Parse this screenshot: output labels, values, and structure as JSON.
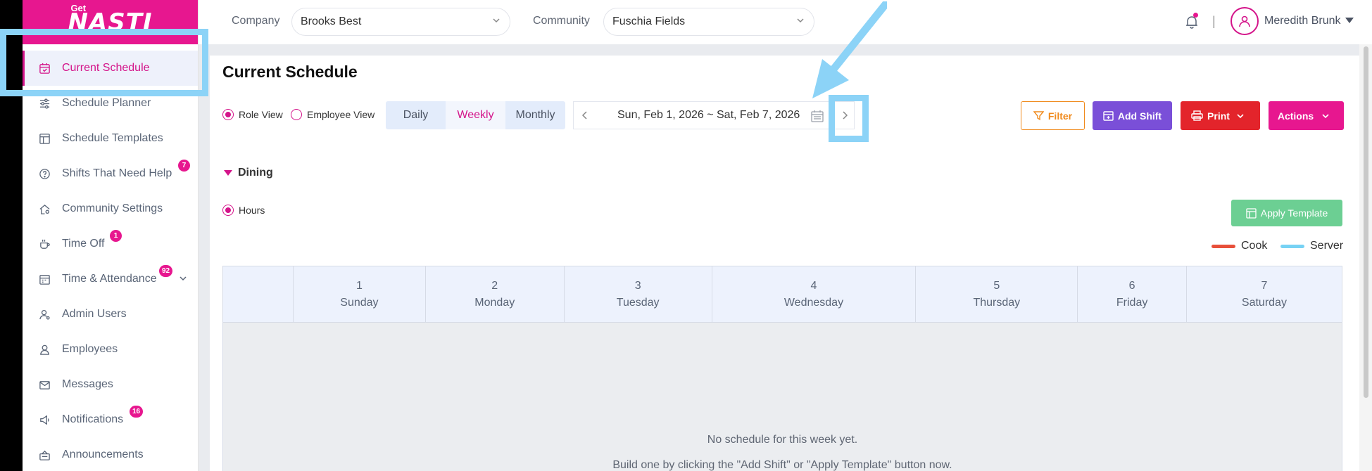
{
  "logo": {
    "text": "NASTI",
    "prefix": "Get"
  },
  "sidebar": {
    "items": [
      {
        "label": "Current Schedule",
        "icon": "calendar-icon",
        "active": true
      },
      {
        "label": "Schedule Planner",
        "icon": "sliders-icon"
      },
      {
        "label": "Schedule Templates",
        "icon": "template-icon"
      },
      {
        "label": "Shifts That Need Help",
        "icon": "help-circle-icon",
        "badge": "7"
      },
      {
        "label": "Community Settings",
        "icon": "home-gear-icon"
      },
      {
        "label": "Time Off",
        "icon": "coffee-icon",
        "badge": "1"
      },
      {
        "label": "Time & Attendance",
        "icon": "calendar-clock-icon",
        "badge": "92"
      },
      {
        "label": "Admin Users",
        "icon": "admin-user-icon"
      },
      {
        "label": "Employees",
        "icon": "user-icon"
      },
      {
        "label": "Messages",
        "icon": "mail-icon"
      },
      {
        "label": "Notifications",
        "icon": "megaphone-icon",
        "badge": "16"
      },
      {
        "label": "Announcements",
        "icon": "announcement-icon"
      }
    ]
  },
  "topbar": {
    "company_label": "Company",
    "company_value": "Brooks Best",
    "community_label": "Community",
    "community_value": "Fuschia Fields",
    "divider": "|",
    "user_name": "Meredith Brunk"
  },
  "main": {
    "title": "Current Schedule",
    "role_view": "Role View",
    "employee_view": "Employee View",
    "tabs": [
      "Daily",
      "Weekly",
      "Monthly"
    ],
    "active_tab": "Weekly",
    "date_range": "Sun, Feb 1, 2026 ~ Sat, Feb 7, 2026",
    "filter_label": "Filter",
    "add_shift_label": "Add Shift",
    "print_label": "Print",
    "actions_label": "Actions",
    "group_name": "Dining",
    "hours_label": "Hours",
    "apply_template_label": "Apply Template",
    "legend": [
      {
        "name": "Cook",
        "color": "#e8503a"
      },
      {
        "name": "Server",
        "color": "#77d2f4"
      }
    ],
    "days": [
      {
        "num": "1",
        "name": "Sunday"
      },
      {
        "num": "2",
        "name": "Monday"
      },
      {
        "num": "3",
        "name": "Tuesday"
      },
      {
        "num": "4",
        "name": "Wednesday"
      },
      {
        "num": "5",
        "name": "Thursday"
      },
      {
        "num": "6",
        "name": "Friday"
      },
      {
        "num": "7",
        "name": "Saturday"
      }
    ],
    "empty_title": "No schedule for this week yet.",
    "empty_hint": "Build one by clicking the \"Add Shift\" or \"Apply Template\" button now."
  },
  "colors": {
    "brand": "#e7178f",
    "add_shift": "#7a4fd8",
    "print": "#e3242b",
    "filter": "#f08a1c",
    "apply_template": "#6ccf93",
    "annotation": "#8cd3f7"
  }
}
